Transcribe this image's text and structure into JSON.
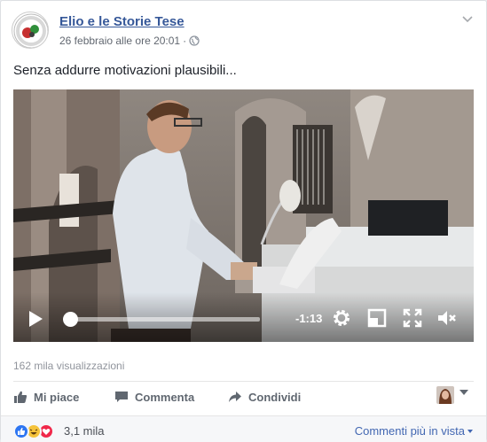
{
  "post": {
    "page_name": "Elio e le Storie Tese",
    "timestamp": "26 febbraio alle ore 20:01",
    "separator": "·",
    "text": "Senza addurre motivazioni plausibili..."
  },
  "video": {
    "time_remaining": "-1:13",
    "progress": 0.02
  },
  "stats": {
    "views": "162 mila visualizzazioni",
    "reaction_count": "3,1 mila"
  },
  "actions": {
    "like_label": "Mi piace",
    "comment_label": "Commenta",
    "share_label": "Condividi"
  },
  "footer": {
    "sort_label": "Commenti più in vista"
  },
  "colors": {
    "link": "#365899",
    "accent": "#4267b2",
    "like_blue": "#2e76f2",
    "haha_yellow": "#f5c33b",
    "love_red": "#f0284a"
  },
  "icons": [
    "page-avatar",
    "globe-icon",
    "chevron-down-icon",
    "play-icon",
    "settings-icon",
    "minimize-icon",
    "fullscreen-icon",
    "mute-icon",
    "like-icon",
    "comment-icon",
    "share-icon",
    "like-reaction-icon",
    "haha-reaction-icon",
    "love-reaction-icon"
  ]
}
